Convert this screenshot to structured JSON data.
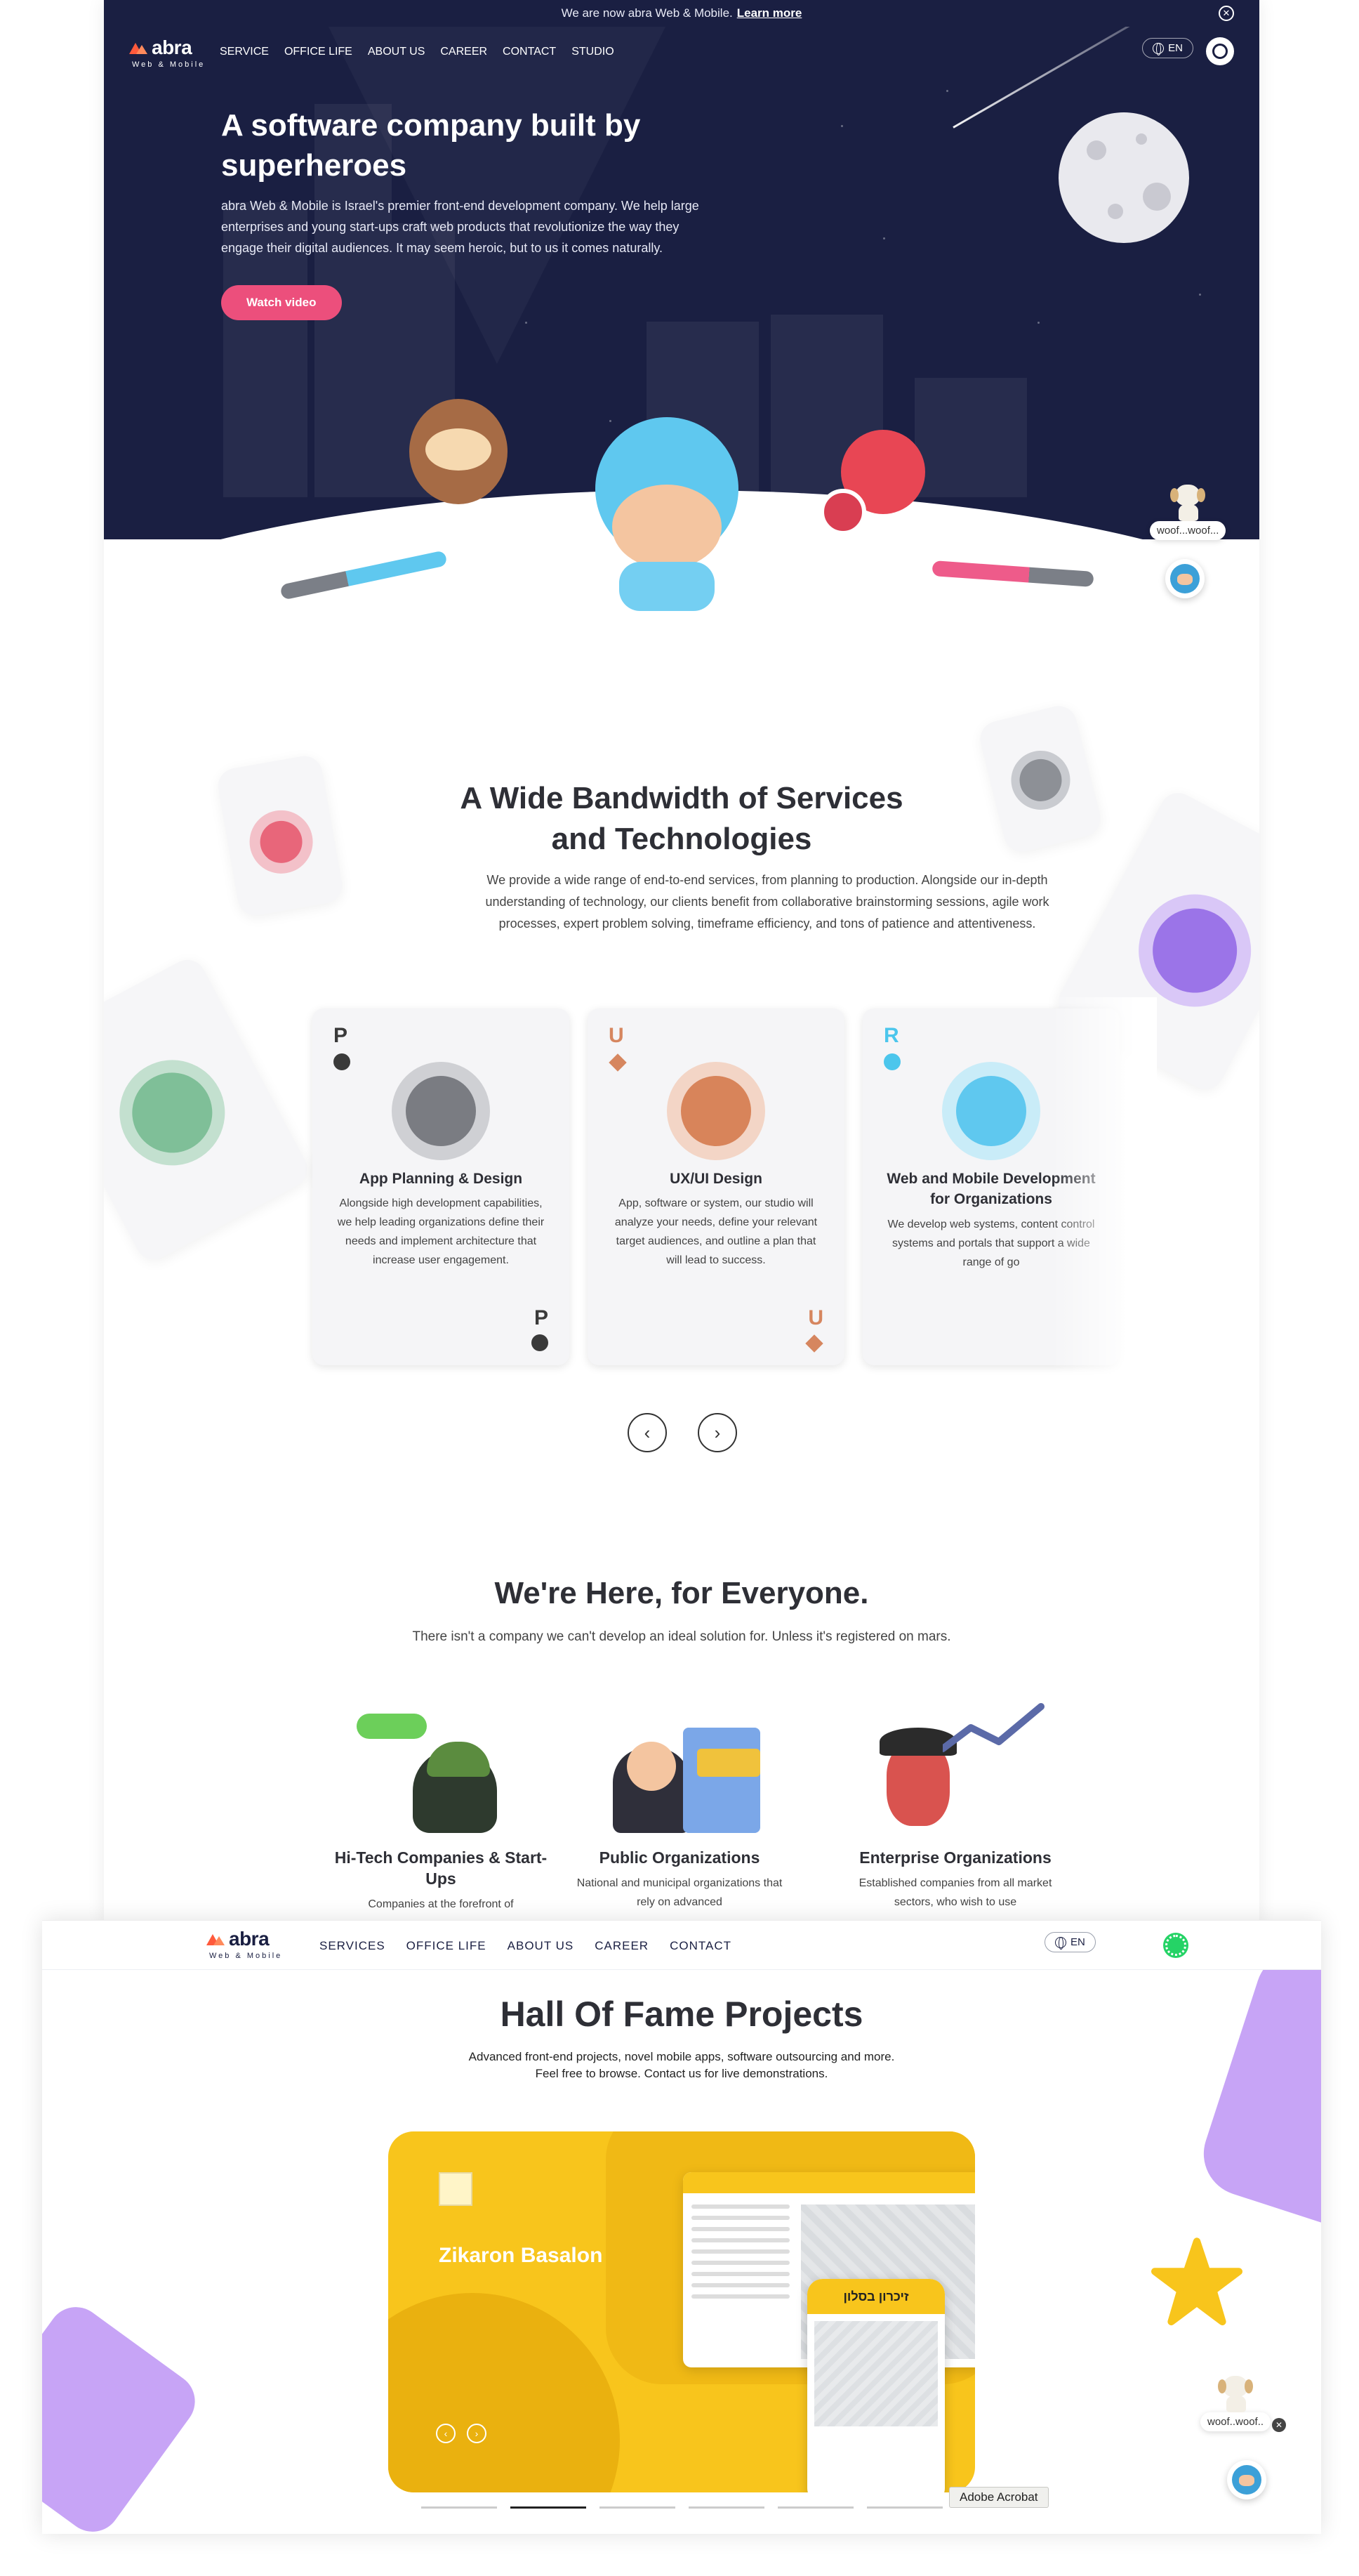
{
  "colors": {
    "hero_bg": "#1a1f42",
    "accent_pink": "#ec4f7c",
    "logo_orange": "#ff5a3c",
    "project_yellow": "#f8c51c",
    "decor_purple": "#c7a4f6",
    "whatsapp_green": "#25d366"
  },
  "announcement": {
    "text": "We are now abra Web & Mobile.",
    "link": "Learn more",
    "close_icon": "close-circle-icon"
  },
  "brand": {
    "name": "abra",
    "tagline": "Web & Mobile"
  },
  "nav": {
    "items": [
      "SERVICE",
      "OFFICE LIFE",
      "ABOUT US",
      "CAREER",
      "CONTACT",
      "STUDIO"
    ],
    "language": "EN",
    "contact_icon": "whatsapp-icon"
  },
  "hero": {
    "title": "A software company built by superheroes",
    "body": "abra Web & Mobile is Israel's premier front-end development company. We help large enterprises and young start-ups craft web products that revolutionize the way they engage their digital audiences. It may seem heroic, but to us it comes naturally.",
    "cta": "Watch video"
  },
  "woof": {
    "label": "woof...woof...",
    "label_short": "woof..woof.."
  },
  "services": {
    "title_line1": "A Wide Bandwidth of Services",
    "title_line2": "and Technologies",
    "description": "We provide a wide range of end-to-end services, from planning to production. Alongside our in-depth understanding of technology, our clients benefit from collaborative brainstorming sessions, agile work processes, expert problem solving, timeframe efficiency, and tons of patience and attentiveness.",
    "cards": [
      {
        "letter": "P",
        "title": "App Planning & Design",
        "text": "Alongside high development capabilities, we help leading organizations define their needs and implement architecture that increase user engagement."
      },
      {
        "letter": "U",
        "title": "UX/UI Design",
        "text": "App, software or system, our studio will analyze your needs, define your relevant target audiences, and outline a plan that will lead to success."
      },
      {
        "letter": "R",
        "title": "Web and Mobile Development for Organizations",
        "text": "We develop web systems, content control systems and portals that support a wide range of go"
      }
    ],
    "prev_icon": "chevron-left-icon",
    "next_icon": "chevron-right-icon"
  },
  "everyone": {
    "title": "We're Here, for Everyone.",
    "description": "There isn't a company we can't develop an ideal solution for. Unless it's registered on mars.",
    "items": [
      {
        "title": "Hi-Tech Companies & Start-Ups",
        "text": "Companies at the forefront of"
      },
      {
        "title": "Public Organizations",
        "text": "National and municipal organizations that rely on advanced"
      },
      {
        "title": "Enterprise Organizations",
        "text": "Established companies from all market sectors, who wish to use"
      }
    ]
  },
  "nav2": {
    "items": [
      "SERVICES",
      "OFFICE LIFE",
      "ABOUT US",
      "CAREER",
      "CONTACT"
    ],
    "language": "EN"
  },
  "hall_of_fame": {
    "title": "Hall Of Fame Projects",
    "line1": "Advanced front-end projects, novel mobile apps, software outsourcing and more.",
    "line2": "Feel free to browse. Contact us for live demonstrations.",
    "project_name": "Zikaron Basalon",
    "phone_header": "זיכרון בסלון",
    "pager_count": 6,
    "active_page": 2
  },
  "tooltip": {
    "label": "Adobe Acrobat"
  }
}
